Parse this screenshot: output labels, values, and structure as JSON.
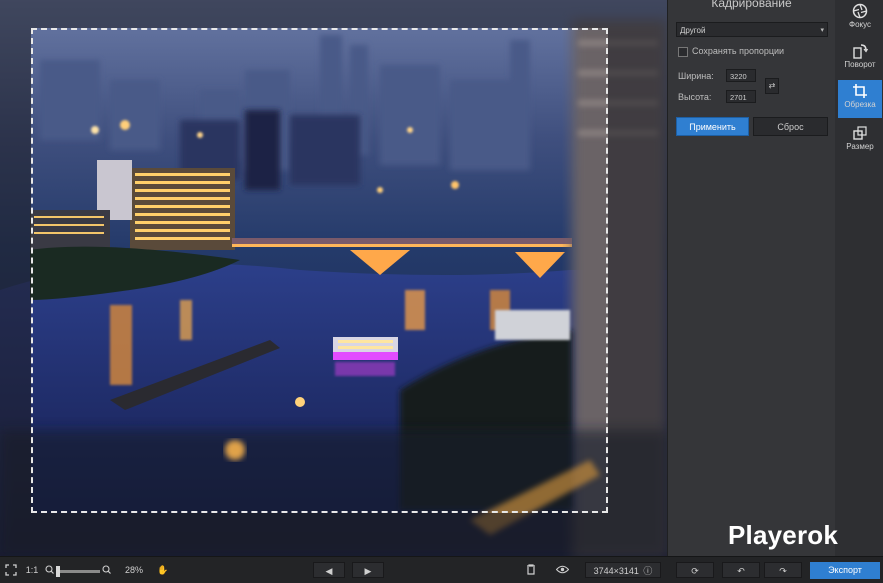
{
  "panel": {
    "title": "Кадрирование",
    "preset_value": "Другой",
    "keep_ratio_label": "Сохранять пропорции",
    "keep_ratio_checked": false,
    "width_label": "Ширина:",
    "width_value": "3220",
    "height_label": "Высота:",
    "height_value": "2701",
    "apply_label": "Применить",
    "reset_label": "Сброс"
  },
  "tools": [
    {
      "label": "Фокус",
      "icon": "aperture-icon",
      "active": false
    },
    {
      "label": "Поворот",
      "icon": "rotate-icon",
      "active": false
    },
    {
      "label": "Обрезка",
      "icon": "crop-icon",
      "active": true
    },
    {
      "label": "Размер",
      "icon": "resize-icon",
      "active": false
    }
  ],
  "bottom": {
    "actual_size_label": "1:1",
    "zoom_percent": "28%",
    "zoom_fraction": 0.1,
    "dimensions": "3744×3141",
    "export_label": "Экспорт"
  },
  "watermark": "Playerok",
  "colors": {
    "accent": "#2f7fd1",
    "panel": "#353639",
    "background": "#2a2b2d"
  }
}
